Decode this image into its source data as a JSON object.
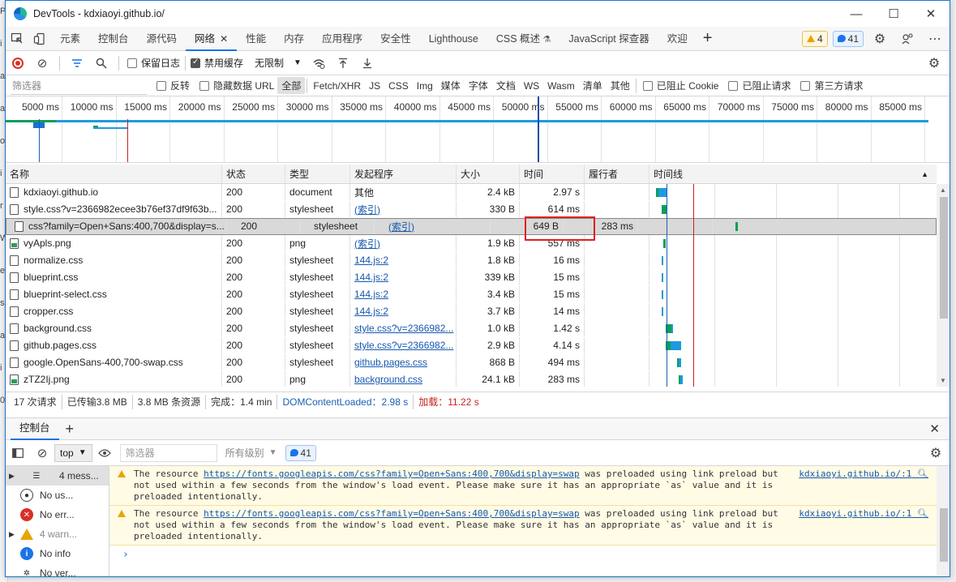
{
  "backdrop": {
    "chars": [
      "P",
      "i",
      "a",
      "a",
      "o",
      "i",
      "r",
      "W",
      "e",
      "s",
      "a",
      "i",
      "0"
    ]
  },
  "window": {
    "title": "DevTools - kdxiaoyi.github.io/",
    "controls": [
      "—",
      "☐",
      "✕"
    ]
  },
  "tabs": {
    "items": [
      "元素",
      "控制台",
      "源代码",
      "网络",
      "性能",
      "内存",
      "应用程序",
      "安全性",
      "Lighthouse",
      "CSS 概述",
      "JavaScript 探查器",
      "欢迎"
    ],
    "active": "网络",
    "css_overview_icon": "flask-icon",
    "warnings": "4",
    "messages": "41"
  },
  "toolbar": {
    "preserve_log": "保留日志",
    "disable_cache": "禁用缓存",
    "throttle": "无限制"
  },
  "filter": {
    "placeholder": "筛选器",
    "invert": "反转",
    "hide_data_url": "隐藏数据 URL",
    "types": [
      "全部",
      "Fetch/XHR",
      "JS",
      "CSS",
      "Img",
      "媒体",
      "字体",
      "文档",
      "WS",
      "Wasm",
      "清单",
      "其他"
    ],
    "blocked_cookies": "已阻止 Cookie",
    "blocked_requests": "已阻止请求",
    "third_party": "第三方请求"
  },
  "overview": {
    "ticks": [
      "5000 ms",
      "10000 ms",
      "15000 ms",
      "20000 ms",
      "25000 ms",
      "30000 ms",
      "35000 ms",
      "40000 ms",
      "45000 ms",
      "50000 ms",
      "55000 ms",
      "60000 ms",
      "65000 ms",
      "70000 ms",
      "75000 ms",
      "80000 ms",
      "85000 ms",
      "900"
    ]
  },
  "table": {
    "headers": {
      "name": "名称",
      "status": "状态",
      "type": "类型",
      "initiator": "发起程序",
      "size": "大小",
      "time": "时间",
      "fulfilled": "履行者",
      "waterfall": "时间线"
    },
    "rows": [
      {
        "name": "kdxiaoyi.github.io",
        "status": "200",
        "type": "document",
        "initiator": "其他",
        "size": "2.4 kB",
        "time": "2.97 s",
        "icon": "file-icon"
      },
      {
        "name": "style.css?v=2366982ecee3b76ef37df9f63b...",
        "status": "200",
        "type": "stylesheet",
        "initiator": "(索引)",
        "size": "330 B",
        "time": "614 ms",
        "icon": "file-icon"
      },
      {
        "name": "css?family=Open+Sans:400,700&display=s...",
        "status": "200",
        "type": "stylesheet",
        "initiator": "(索引)",
        "size": "649 B",
        "time": "283 ms",
        "icon": "file-icon"
      },
      {
        "name": "vyApls.png",
        "status": "200",
        "type": "png",
        "initiator": "(索引)",
        "size": "1.9 kB",
        "time": "557 ms",
        "icon": "image-file-icon"
      },
      {
        "name": "normalize.css",
        "status": "200",
        "type": "stylesheet",
        "initiator": "144.js:2",
        "size": "1.8 kB",
        "time": "16 ms",
        "icon": "file-icon"
      },
      {
        "name": "blueprint.css",
        "status": "200",
        "type": "stylesheet",
        "initiator": "144.js:2",
        "size": "339 kB",
        "time": "15 ms",
        "icon": "file-icon"
      },
      {
        "name": "blueprint-select.css",
        "status": "200",
        "type": "stylesheet",
        "initiator": "144.js:2",
        "size": "3.4 kB",
        "time": "15 ms",
        "icon": "file-icon"
      },
      {
        "name": "cropper.css",
        "status": "200",
        "type": "stylesheet",
        "initiator": "144.js:2",
        "size": "3.7 kB",
        "time": "14 ms",
        "icon": "file-icon"
      },
      {
        "name": "background.css",
        "status": "200",
        "type": "stylesheet",
        "initiator": "style.css?v=2366982...",
        "size": "1.0 kB",
        "time": "1.42 s",
        "icon": "file-icon"
      },
      {
        "name": "github.pages.css",
        "status": "200",
        "type": "stylesheet",
        "initiator": "style.css?v=2366982...",
        "size": "2.9 kB",
        "time": "4.14 s",
        "icon": "file-icon"
      },
      {
        "name": "google.OpenSans-400,700-swap.css",
        "status": "200",
        "type": "stylesheet",
        "initiator": "github.pages.css",
        "size": "868 B",
        "time": "494 ms",
        "icon": "file-icon"
      },
      {
        "name": "zTZ2Ij.png",
        "status": "200",
        "type": "png",
        "initiator": "background.css",
        "size": "24.1 kB",
        "time": "283 ms",
        "icon": "image-file-icon"
      }
    ]
  },
  "status": {
    "requests": "17 次请求",
    "transferred": "已传输3.8 MB",
    "resources": "3.8 MB 条资源",
    "finish": "完成：1.4 min",
    "dcl_label": "DOMContentLoaded：",
    "dcl_value": "2.98 s",
    "load_label": "加载：",
    "load_value": "11.22 s"
  },
  "drawer": {
    "tab": "控制台",
    "context": "top",
    "filter_placeholder": "筛选器",
    "levels": "所有级别",
    "msg_count": "41",
    "sidebar": [
      "4 mess...",
      "No us...",
      "No err...",
      "4 warn...",
      "No info",
      "No ver..."
    ],
    "messages": [
      {
        "prefix": "The resource ",
        "url": "https://fonts.googleapis.com/css?family=Open+Sans:400,700&display=swap",
        "rest": " was preloaded using link preload but not used within a few seconds from the window's load event. Please make sure it has an appropriate `as` value and it is preloaded intentionally.",
        "source": "kdxiaoyi.github.io/:1"
      },
      {
        "prefix": "The resource ",
        "url": "https://fonts.googleapis.com/css?family=Open+Sans:400,700&display=swap",
        "rest": " was preloaded using link preload but not used within a few seconds from the window's load event. Please make sure it has an appropriate `as` value and it is preloaded intentionally.",
        "source": "kdxiaoyi.github.io/:1"
      }
    ],
    "prompt": "›"
  },
  "colors": {
    "accent": "#1a73e8",
    "waiting": "#0f9d58",
    "download": "#1e9ae0",
    "dcl": "#1a5fb4",
    "load": "#c5221f",
    "highlight": "#e02020"
  }
}
